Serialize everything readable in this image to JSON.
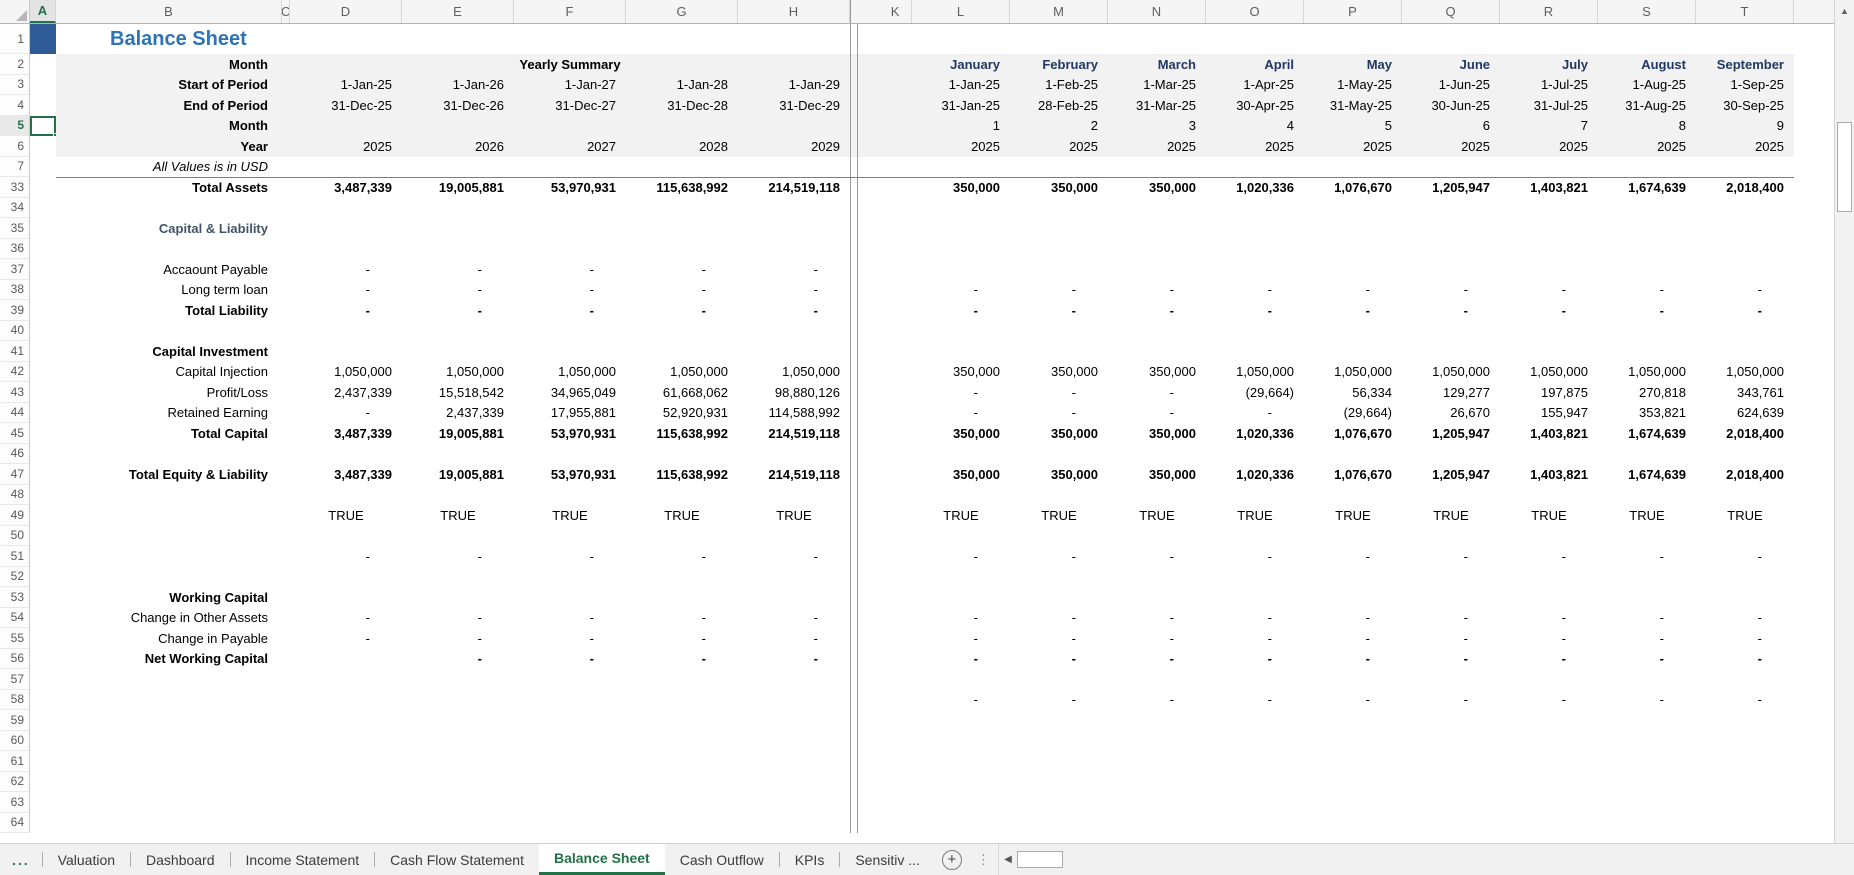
{
  "sheet": {
    "title": "Balance Sheet",
    "active_cell": "A5",
    "yearly_summary_label": "Yearly Summary",
    "unit_note": "All Values is in USD"
  },
  "colors": {
    "accent_green": "#217346",
    "title_blue": "#2E74B5",
    "month_header_navy": "#1F3864",
    "section_heading_slate": "#44546A",
    "a1_cell_fill": "#2E5B97",
    "header_fill_gray": "#F2F2F2"
  },
  "columns": {
    "left_letters": [
      "A",
      "B",
      "C",
      "D",
      "E",
      "F",
      "G",
      "H"
    ],
    "sliver_letters": "I K",
    "right_letters": [
      "L",
      "M",
      "N",
      "O",
      "P",
      "Q",
      "R",
      "S",
      "T"
    ]
  },
  "row_numbers": [
    1,
    2,
    3,
    4,
    5,
    6,
    7,
    33,
    34,
    35,
    36,
    37,
    38,
    39,
    40,
    41,
    42,
    43,
    44,
    45,
    46,
    47,
    48,
    49,
    50,
    51,
    52,
    53,
    54,
    55,
    56,
    57,
    58,
    59,
    60,
    61,
    62,
    63,
    64
  ],
  "rows": [
    {
      "n": 2,
      "label": "Month",
      "lb": true,
      "gray": true,
      "merged_yearly": "Yearly Summary",
      "monthly": [
        "January",
        "February",
        "March",
        "April",
        "May",
        "June",
        "July",
        "August",
        "September"
      ],
      "month_header": true
    },
    {
      "n": 3,
      "label": "Start of Period",
      "lb": true,
      "gray": true,
      "yearly": [
        "1-Jan-25",
        "1-Jan-26",
        "1-Jan-27",
        "1-Jan-28",
        "1-Jan-29"
      ],
      "monthly": [
        "1-Jan-25",
        "1-Feb-25",
        "1-Mar-25",
        "1-Apr-25",
        "1-May-25",
        "1-Jun-25",
        "1-Jul-25",
        "1-Aug-25",
        "1-Sep-25"
      ]
    },
    {
      "n": 4,
      "label": "End of Period",
      "lb": true,
      "gray": true,
      "yearly": [
        "31-Dec-25",
        "31-Dec-26",
        "31-Dec-27",
        "31-Dec-28",
        "31-Dec-29"
      ],
      "monthly": [
        "31-Jan-25",
        "28-Feb-25",
        "31-Mar-25",
        "30-Apr-25",
        "31-May-25",
        "30-Jun-25",
        "31-Jul-25",
        "31-Aug-25",
        "30-Sep-25"
      ]
    },
    {
      "n": 5,
      "label": "Month",
      "lb": true,
      "gray": true,
      "active_cell": true,
      "yearly": [
        "",
        "",
        "",
        "",
        ""
      ],
      "monthly": [
        "1",
        "2",
        "3",
        "4",
        "5",
        "6",
        "7",
        "8",
        "9"
      ]
    },
    {
      "n": 6,
      "label": "Year",
      "lb": true,
      "gray": true,
      "yearly": [
        "2025",
        "2026",
        "2027",
        "2028",
        "2029"
      ],
      "monthly": [
        "2025",
        "2025",
        "2025",
        "2025",
        "2025",
        "2025",
        "2025",
        "2025",
        "2025"
      ]
    },
    {
      "n": 7,
      "label": "All Values is in USD",
      "italic": true
    },
    {
      "n": 33,
      "label": "Total Assets",
      "lb": true,
      "vb": true,
      "topline": true,
      "yearly": [
        "3,487,339",
        "19,005,881",
        "53,970,931",
        "115,638,992",
        "214,519,118"
      ],
      "monthly": [
        "350,000",
        "350,000",
        "350,000",
        "1,020,336",
        "1,076,670",
        "1,205,947",
        "1,403,821",
        "1,674,639",
        "2,018,400"
      ]
    },
    {
      "n": 34
    },
    {
      "n": 35,
      "label": "Capital & Liability",
      "lb": true,
      "heading": true
    },
    {
      "n": 36
    },
    {
      "n": 37,
      "label": "Accaount Payable",
      "yearly": [
        "-",
        "-",
        "-",
        "-",
        "-"
      ],
      "monthly": [
        "",
        "",
        "",
        "",
        "",
        "",
        "",
        "",
        ""
      ]
    },
    {
      "n": 38,
      "label": "Long term loan",
      "yearly": [
        "-",
        "-",
        "-",
        "-",
        "-"
      ],
      "monthly": [
        "-",
        "-",
        "-",
        "-",
        "-",
        "-",
        "-",
        "-",
        "-"
      ]
    },
    {
      "n": 39,
      "label": "Total Liability",
      "lb": true,
      "vb": true,
      "yearly": [
        "-",
        "-",
        "-",
        "-",
        "-"
      ],
      "monthly": [
        "-",
        "-",
        "-",
        "-",
        "-",
        "-",
        "-",
        "-",
        "-"
      ]
    },
    {
      "n": 40
    },
    {
      "n": 41,
      "label": "Capital Investment",
      "lb": true
    },
    {
      "n": 42,
      "label": "Capital Injection",
      "yearly": [
        "1,050,000",
        "1,050,000",
        "1,050,000",
        "1,050,000",
        "1,050,000"
      ],
      "monthly": [
        "350,000",
        "350,000",
        "350,000",
        "1,050,000",
        "1,050,000",
        "1,050,000",
        "1,050,000",
        "1,050,000",
        "1,050,000"
      ]
    },
    {
      "n": 43,
      "label": "Profit/Loss",
      "yearly": [
        "2,437,339",
        "15,518,542",
        "34,965,049",
        "61,668,062",
        "98,880,126"
      ],
      "monthly": [
        "-",
        "-",
        "-",
        "(29,664)",
        "56,334",
        "129,277",
        "197,875",
        "270,818",
        "343,761"
      ]
    },
    {
      "n": 44,
      "label": "Retained Earning",
      "yearly": [
        "-",
        "2,437,339",
        "17,955,881",
        "52,920,931",
        "114,588,992"
      ],
      "monthly": [
        "-",
        "-",
        "-",
        "-",
        "(29,664)",
        "26,670",
        "155,947",
        "353,821",
        "624,639"
      ]
    },
    {
      "n": 45,
      "label": "Total Capital",
      "lb": true,
      "vb": true,
      "yearly": [
        "3,487,339",
        "19,005,881",
        "53,970,931",
        "115,638,992",
        "214,519,118"
      ],
      "monthly": [
        "350,000",
        "350,000",
        "350,000",
        "1,020,336",
        "1,076,670",
        "1,205,947",
        "1,403,821",
        "1,674,639",
        "2,018,400"
      ]
    },
    {
      "n": 46
    },
    {
      "n": 47,
      "label": "Total Equity & Liability",
      "lb": true,
      "vb": true,
      "yearly": [
        "3,487,339",
        "19,005,881",
        "53,970,931",
        "115,638,992",
        "214,519,118"
      ],
      "monthly": [
        "350,000",
        "350,000",
        "350,000",
        "1,020,336",
        "1,076,670",
        "1,205,947",
        "1,403,821",
        "1,674,639",
        "2,018,400"
      ]
    },
    {
      "n": 48
    },
    {
      "n": 49,
      "yearly": [
        "TRUE",
        "TRUE",
        "TRUE",
        "TRUE",
        "TRUE"
      ],
      "monthly": [
        "TRUE",
        "TRUE",
        "TRUE",
        "TRUE",
        "TRUE",
        "TRUE",
        "TRUE",
        "TRUE",
        "TRUE"
      ]
    },
    {
      "n": 50
    },
    {
      "n": 51,
      "yearly": [
        "-",
        "-",
        "-",
        "-",
        "-"
      ],
      "monthly": [
        "-",
        "-",
        "-",
        "-",
        "-",
        "-",
        "-",
        "-",
        "-"
      ]
    },
    {
      "n": 52
    },
    {
      "n": 53,
      "label": "Working Capital",
      "lb": true
    },
    {
      "n": 54,
      "label": "Change in Other Assets",
      "yearly": [
        "-",
        "-",
        "-",
        "-",
        "-"
      ],
      "monthly": [
        "-",
        "-",
        "-",
        "-",
        "-",
        "-",
        "-",
        "-",
        "-"
      ]
    },
    {
      "n": 55,
      "label": "Change in Payable",
      "yearly": [
        "-",
        "-",
        "-",
        "-",
        "-"
      ],
      "monthly": [
        "-",
        "-",
        "-",
        "-",
        "-",
        "-",
        "-",
        "-",
        "-"
      ]
    },
    {
      "n": 56,
      "label": "Net Working Capital",
      "lb": true,
      "vb": true,
      "yearly": [
        "",
        "-",
        "-",
        "-",
        "-"
      ],
      "monthly": [
        "-",
        "-",
        "-",
        "-",
        "-",
        "-",
        "-",
        "-",
        "-"
      ]
    },
    {
      "n": 57
    },
    {
      "n": 58,
      "monthly": [
        "-",
        "-",
        "-",
        "-",
        "-",
        "-",
        "-",
        "-",
        "-"
      ]
    },
    {
      "n": 59
    },
    {
      "n": 60
    },
    {
      "n": 61
    },
    {
      "n": 62
    },
    {
      "n": 63
    },
    {
      "n": 64
    }
  ],
  "tab_bar": {
    "overflow_indicator": "...",
    "tabs": [
      {
        "label": "Valuation",
        "active": false
      },
      {
        "label": "Dashboard",
        "active": false
      },
      {
        "label": "Income Statement",
        "active": false
      },
      {
        "label": "Cash Flow Statement",
        "active": false
      },
      {
        "label": "Balance Sheet",
        "active": true
      },
      {
        "label": "Cash Outflow",
        "active": false
      },
      {
        "label": "KPIs",
        "active": false
      },
      {
        "label": "Sensitiv ...",
        "active": false
      }
    ],
    "icons": {
      "add_sheet": "+",
      "drag_handle": "⋮",
      "scroll_left": "◀",
      "scroll_up": "▲"
    }
  }
}
